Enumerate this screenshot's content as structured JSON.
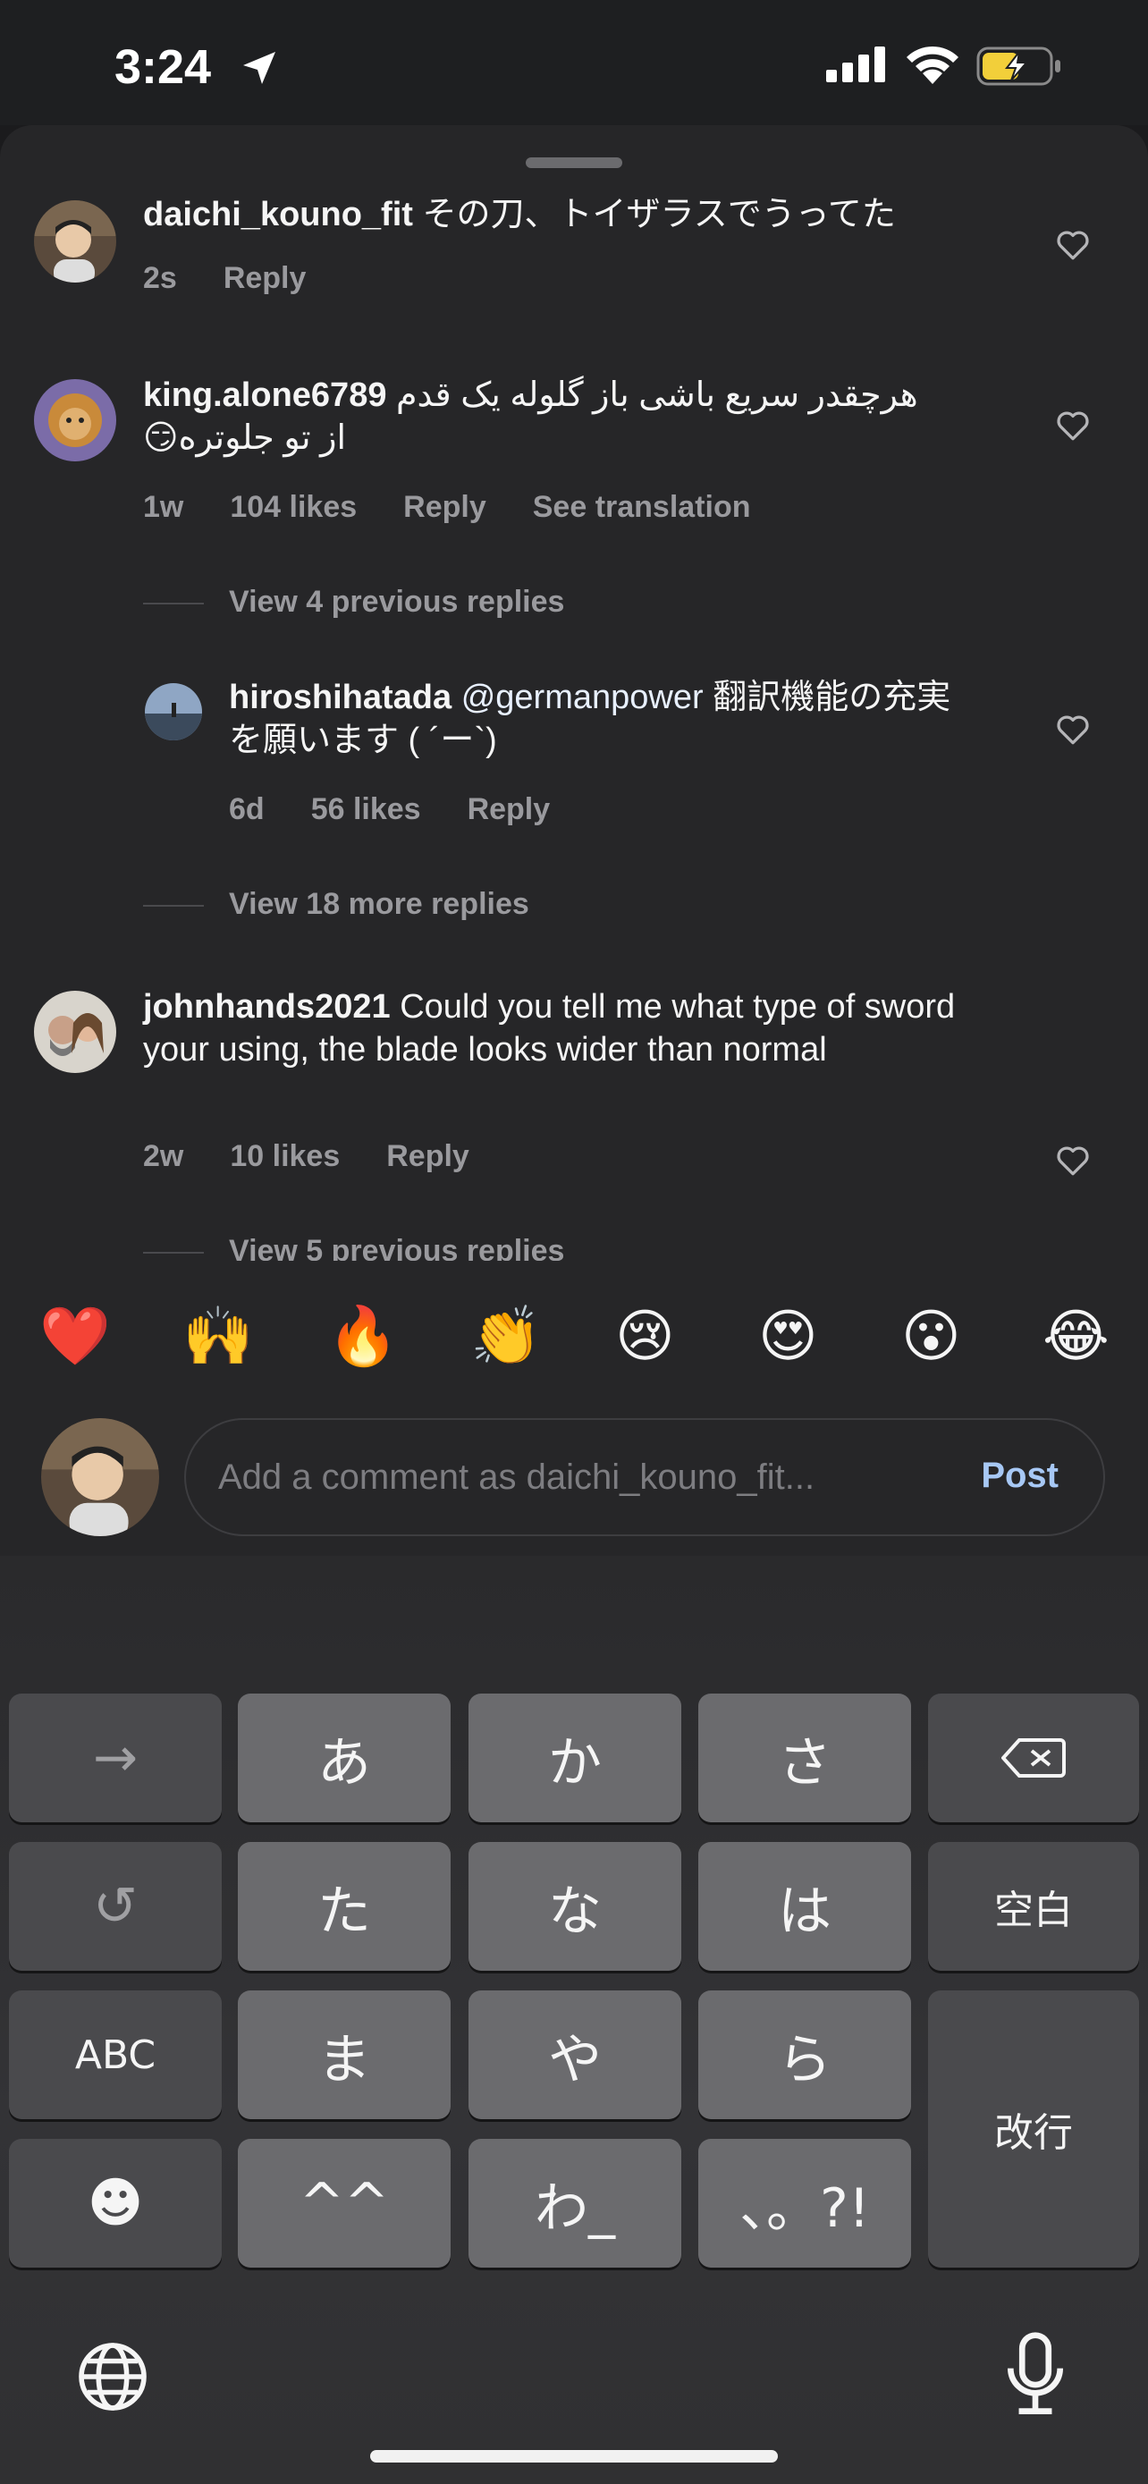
{
  "status": {
    "time": "3:24",
    "icons": [
      "location-arrow-icon",
      "signal-icon",
      "wifi-icon",
      "battery-charging-icon"
    ]
  },
  "comments": [
    {
      "user": "daichi_kouno_fit",
      "text": " その刀、トイザラスでうってた",
      "age": "2s",
      "reply": "Reply"
    },
    {
      "user": "king.alone6789",
      "text": "هرچقدر سریع باشی باز گلوله یک قدم از تو جلوتره😏",
      "age": "1w",
      "likes": "104 likes",
      "reply": "Reply",
      "translate": "See translation"
    }
  ],
  "threads": [
    {
      "label": "View 4 previous replies"
    },
    {
      "label": "View 18 more replies"
    },
    {
      "label": "View 5 previous replies"
    }
  ],
  "reply": {
    "user": "hiroshihatada",
    "mention": "@germanpower",
    "text": " 翻訳機能の充実を願います ( ´ー`)",
    "age": "6d",
    "likes": "56 likes",
    "reply": "Reply"
  },
  "comment3": {
    "user": "johnhands2021",
    "text": " Could you tell me what type of sword your using, the blade looks wider than normal",
    "age": "2w",
    "likes": "10 likes",
    "reply": "Reply"
  },
  "emojis": [
    "❤️",
    "🙌",
    "🔥",
    "👏",
    "😢",
    "😍",
    "😮",
    "😂"
  ],
  "composer": {
    "placeholder": "Add a comment as daichi_kouno_fit...",
    "post_label": "Post"
  },
  "keyboard": {
    "row1": [
      "→",
      "あ",
      "か",
      "さ",
      "⌫"
    ],
    "row2": [
      "↺",
      "た",
      "な",
      "は",
      "空白"
    ],
    "row3": [
      "ABC",
      "ま",
      "や",
      "ら"
    ],
    "row4": [
      "☻",
      "^^",
      "わ_",
      "、。?!"
    ],
    "enter": "改行"
  },
  "colors": {
    "background": "#262628",
    "post": "#a7c8f5",
    "meta": "#9a9a9e"
  }
}
